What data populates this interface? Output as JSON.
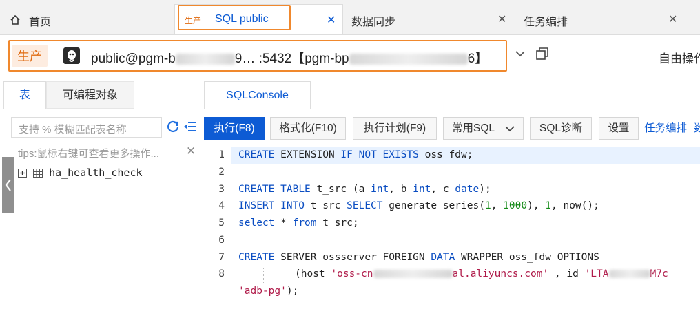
{
  "tabs": {
    "home": {
      "label": "首页"
    },
    "sql_public": {
      "env": "生产",
      "label": "SQL public"
    },
    "data_sync": {
      "label": "数据同步"
    },
    "task_orch": {
      "label": "任务编排"
    }
  },
  "connection": {
    "env": "生产",
    "text_a": "public@pgm-b",
    "text_b": "9… :5432【pgm-bp",
    "text_c": "6】",
    "right_label": "自由操作"
  },
  "left": {
    "tab_table": "表",
    "tab_programmable": "可编程对象",
    "search_placeholder": "支持 % 模糊匹配表名称",
    "tips": "tips:鼠标右键可查看更多操作...",
    "tree_item": "ha_health_check"
  },
  "console": {
    "tab": "SQLConsole",
    "toolbar": {
      "execute": "执行(F8)",
      "format": "格式化(F10)",
      "plan": "执行计划(F9)",
      "common_sql": "常用SQL",
      "diagnose": "SQL诊断",
      "settings": "设置",
      "task_orch": "任务编排",
      "more": "数"
    }
  },
  "editor": {
    "line_numbers": [
      "1",
      "2",
      "3",
      "4",
      "5",
      "6",
      "7",
      "8"
    ],
    "lines": {
      "l1": {
        "kw1": "CREATE",
        "t1": " EXTENSION ",
        "kw2": "IF NOT EXISTS",
        "t2": " oss_fdw;"
      },
      "l3": {
        "kw1": "CREATE",
        "t1": " ",
        "kw2": "TABLE",
        "t2": " t_src (a ",
        "kw3": "int",
        "t3": ", b ",
        "kw4": "int",
        "t4": ", c ",
        "kw5": "date",
        "t5": ");"
      },
      "l4": {
        "kw1": "INSERT INTO",
        "t1": " t_src ",
        "kw2": "SELECT",
        "t2": " generate_series(",
        "n1": "1",
        "t3": ", ",
        "n2": "1000",
        "t4": "), ",
        "n3": "1",
        "t5": ", now();"
      },
      "l5": {
        "kw1": "select",
        "t1": " * ",
        "kw2": "from",
        "t2": " t_src;"
      },
      "l7": {
        "kw1": "CREATE",
        "t1": " SERVER ossserver FOREIGN ",
        "kw2": "DATA",
        "t2": " WRAPPER oss_fdw OPTIONS"
      },
      "l8": {
        "t1": "(host ",
        "s1": "'oss-cn",
        "s2": "al.aliyuncs.com'",
        "t2": " , id ",
        "s3": "'LTA",
        "s4": "M7c"
      },
      "l9": {
        "s1": "'adb-pg'",
        "t1": ");"
      }
    }
  }
}
